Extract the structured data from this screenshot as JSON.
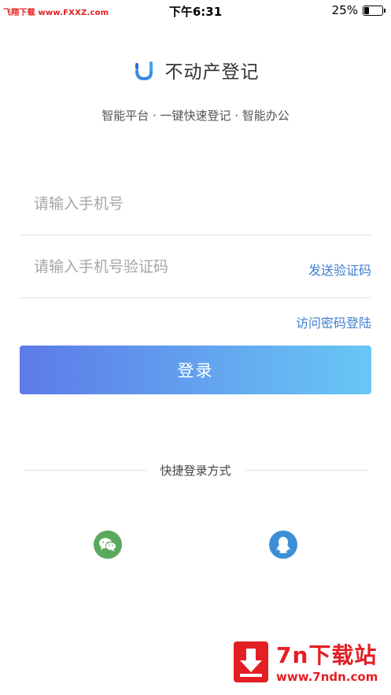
{
  "status_bar": {
    "watermark": "飞翔下载 www.FXXZ.com",
    "time": "下午6:31",
    "battery_percent": "25%",
    "battery_level": 0.25
  },
  "header": {
    "app_title": "不动产登记",
    "tagline": "智能平台 · 一键快速登记 · 智能办公"
  },
  "form": {
    "phone_placeholder": "请输入手机号",
    "code_placeholder": "请输入手机号验证码",
    "send_code_label": "发送验证码",
    "password_login_label": "访问密码登陆",
    "login_button": "登录"
  },
  "quick_login": {
    "label": "快捷登录方式",
    "options": [
      {
        "icon": "wechat-icon",
        "color": "#5aa85d"
      },
      {
        "icon": "qq-icon",
        "color": "#3d8fd5"
      }
    ]
  },
  "footer_ad": {
    "title": "7n下载站",
    "url": "www.7ndn.com"
  },
  "colors": {
    "accent_link": "#3f7fce",
    "button_gradient_start": "#5d7ae8",
    "button_gradient_end": "#68c7f4"
  }
}
